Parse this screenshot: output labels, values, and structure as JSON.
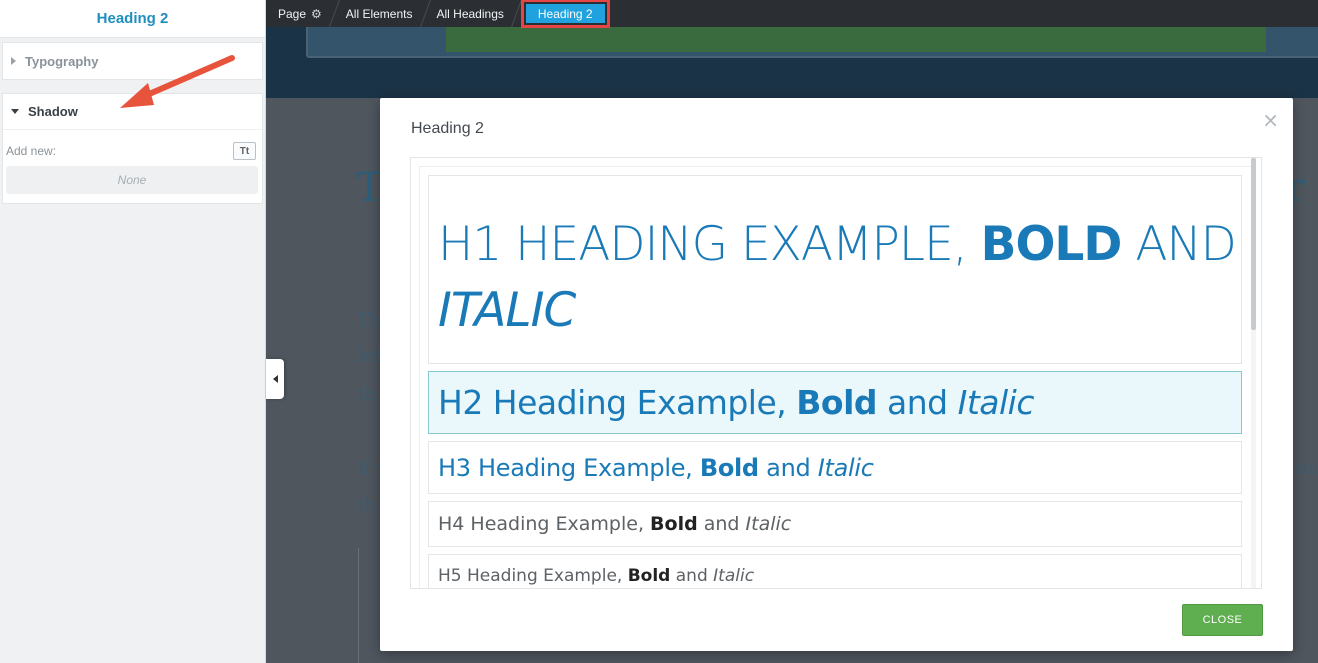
{
  "sidebar": {
    "title": "Heading 2",
    "sections": [
      {
        "label": "Typography",
        "expanded": false
      },
      {
        "label": "Shadow",
        "expanded": true
      }
    ],
    "add_new_label": "Add new:",
    "text_shadow_button": "Tt",
    "none_placeholder": "None"
  },
  "breadcrumb": {
    "items": [
      "Page",
      "All Elements",
      "All Headings",
      "Heading 2"
    ],
    "active_index": 3
  },
  "modal": {
    "title": "Heading 2",
    "close_x": "×",
    "headings": [
      {
        "level": "H1",
        "plain": "H1 HEADING EXAMPLE, ",
        "bold": "BOLD",
        "mid": " AND ",
        "italic": "ITALIC"
      },
      {
        "level": "H2",
        "plain": "H2 Heading Example, ",
        "bold": "Bold",
        "mid": " and ",
        "italic": "Italic",
        "selected": true
      },
      {
        "level": "H3",
        "plain": "H3 Heading Example, ",
        "bold": "Bold",
        "mid": " and ",
        "italic": "Italic"
      },
      {
        "level": "H4",
        "plain": "H4 Heading Example, ",
        "bold": "Bold",
        "mid": " and ",
        "italic": "Italic"
      },
      {
        "level": "H5",
        "plain": "H5 Heading Example, ",
        "bold": "Bold",
        "mid": " and ",
        "italic": "Italic"
      }
    ],
    "close_button": "CLOSE"
  },
  "colors": {
    "accent": "#1fa2dd",
    "heading_blue": "#1a7ab8",
    "close_green": "#5fae4f",
    "highlight_red": "#e64545"
  }
}
